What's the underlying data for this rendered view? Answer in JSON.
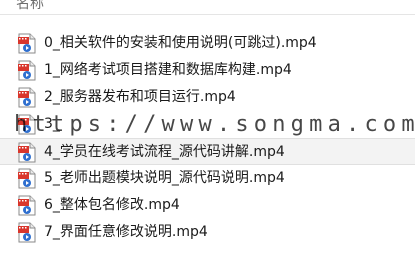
{
  "column_header": {
    "name_label": "名称"
  },
  "files": [
    {
      "name": "0_相关软件的安装和使用说明(可跳过).mp4",
      "icon": "video-file-icon"
    },
    {
      "name": "1_网络考试项目搭建和数据库构建.mp4",
      "icon": "video-file-icon"
    },
    {
      "name": "2_服务器发布和项目运行.mp4",
      "icon": "video-file-icon"
    },
    {
      "name": "3_",
      "icon": "video-file-icon"
    },
    {
      "name": "4_学员在线考试流程_源代码讲解.mp4",
      "icon": "video-file-icon",
      "selected": true
    },
    {
      "name": "5_老师出题模块说明_源代码说明.mp4",
      "icon": "video-file-icon"
    },
    {
      "name": "6_整体包名修改.mp4",
      "icon": "video-file-icon"
    },
    {
      "name": "7_界面任意修改说明.mp4",
      "icon": "video-file-icon"
    }
  ],
  "watermark": {
    "text": "https://www.songma.com"
  },
  "colors": {
    "icon_blue": "#2f6fcf",
    "icon_red": "#d9362c",
    "selection_bg": "#f3f3f3"
  }
}
